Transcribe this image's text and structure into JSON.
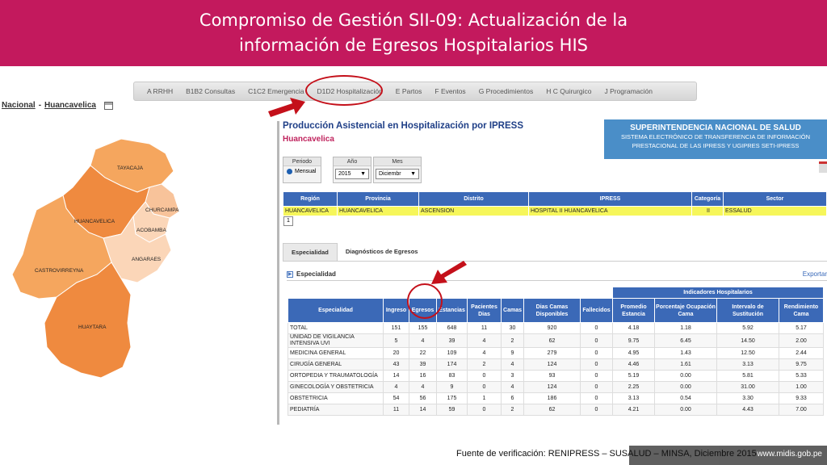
{
  "header": {
    "title_line1": "Compromiso de Gestión SII-09: Actualización de la",
    "title_line2": "información de Egresos Hospitalarios HIS"
  },
  "tabs": [
    "A RRHH",
    "B1B2 Consultas",
    "C1C2 Emergencia",
    "D1D2 Hospitalización",
    "E Partos",
    "F Eventos",
    "G Procedimientos",
    "H C Quirurgico",
    "J Programación"
  ],
  "breadcrumb": {
    "level1": "Nacional",
    "sep": "-",
    "level2": "Huancavelica"
  },
  "map": {
    "provinces": [
      "TAYACAJA",
      "CHURCAMPA",
      "HUANCAVELICA",
      "ACOBAMBA",
      "ANGARAES",
      "CASTROVIRREYNA",
      "HUAYTARA"
    ],
    "colors": {
      "dark": "#ef8a3f",
      "mid": "#f5a65e",
      "light": "#f8c39a",
      "lighter": "#fbd6b8"
    }
  },
  "panel": {
    "title": "Producción Asistencial en Hospitalización por IPRESS",
    "subtitle": "Huancavelica",
    "susalud_title": "SUPERINTENDENCIA NACIONAL DE SALUD",
    "susalud_line1": "SISTEMA ELECTRÓNICO DE TRANSFERENCIA DE INFORMACIÓN",
    "susalud_line2": "PRESTACIONAL DE LAS IPRESS Y UGIPRES SETI-IPRESS",
    "periodo_label": "Periodo",
    "periodo_value": "Mensual",
    "anio_label": "Año",
    "anio_value": "2015",
    "mes_label": "Mes",
    "mes_value": "Diciembr"
  },
  "ipress_table": {
    "headers": [
      "Región",
      "Provincia",
      "Distrito",
      "IPRESS",
      "Categoría",
      "Sector"
    ],
    "row": [
      "HUANCAVELICA",
      "HUANCAVELICA",
      "ASCENSION",
      "HOSPITAL II HUANCAVELICA",
      "II",
      "ESSALUD"
    ],
    "page": "1"
  },
  "subtabs": [
    "Especialidad",
    "Diagnósticos de Egresos"
  ],
  "section": {
    "label": "Especialidad",
    "export": "Exportar"
  },
  "spec_table": {
    "group_header": "Indicadores Hospitalarios",
    "headers": [
      "Especialidad",
      "Ingreso",
      "Egresos",
      "Estancias",
      "Pacientes Dias",
      "Camas",
      "Dias Camas Disponibles",
      "Fallecidos",
      "Promedio Estancia",
      "Porcentaje Ocupación Cama",
      "Intervalo de Sustitución",
      "Rendimiento Cama"
    ],
    "rows": [
      [
        "TOTAL",
        "151",
        "155",
        "648",
        "11",
        "30",
        "920",
        "0",
        "4.18",
        "1.18",
        "5.92",
        "5.17"
      ],
      [
        "UNIDAD DE VIGILANCIA INTENSIVA UVI",
        "5",
        "4",
        "39",
        "4",
        "2",
        "62",
        "0",
        "9.75",
        "6.45",
        "14.50",
        "2.00"
      ],
      [
        "MEDICINA GENERAL",
        "20",
        "22",
        "109",
        "4",
        "9",
        "279",
        "0",
        "4.95",
        "1.43",
        "12.50",
        "2.44"
      ],
      [
        "CIRUGÍA GENERAL",
        "43",
        "39",
        "174",
        "2",
        "4",
        "124",
        "0",
        "4.46",
        "1.61",
        "3.13",
        "9.75"
      ],
      [
        "ORTOPEDIA Y TRAUMATOLOGÍA",
        "14",
        "16",
        "83",
        "0",
        "3",
        "93",
        "0",
        "5.19",
        "0.00",
        "5.81",
        "5.33"
      ],
      [
        "GINECOLOGÍA Y OBSTETRICIA",
        "4",
        "4",
        "9",
        "0",
        "4",
        "124",
        "0",
        "2.25",
        "0.00",
        "31.00",
        "1.00"
      ],
      [
        "OBSTETRICIA",
        "54",
        "56",
        "175",
        "1",
        "6",
        "186",
        "0",
        "3.13",
        "0.54",
        "3.30",
        "9.33"
      ],
      [
        "PEDIATRÍA",
        "11",
        "14",
        "59",
        "0",
        "2",
        "62",
        "0",
        "4.21",
        "0.00",
        "4.43",
        "7.00"
      ]
    ]
  },
  "footer": {
    "source": "Fuente de verificación: RENIPRESS – SUSALUD – MINSA, Diciembre 2015",
    "site": "www.midis.gob.pe"
  }
}
